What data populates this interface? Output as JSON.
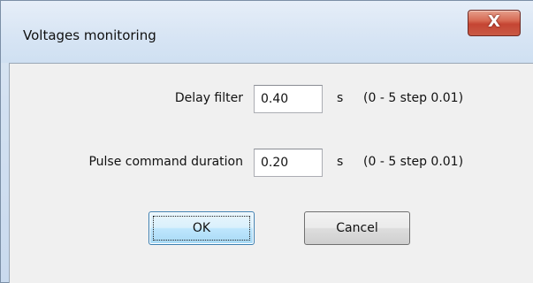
{
  "window": {
    "title": "Voltages monitoring",
    "close_glyph": "X",
    "close_icon": "close-icon"
  },
  "form": {
    "delay_filter": {
      "label": "Delay filter",
      "value": "0.40",
      "unit": "s",
      "range": "(0 - 5 step 0.01)"
    },
    "pulse_command_duration": {
      "label": "Pulse command duration",
      "value": "0.20",
      "unit": "s",
      "range": "(0 - 5 step 0.01)"
    }
  },
  "buttons": {
    "ok_label": "OK",
    "cancel_label": "Cancel"
  },
  "colors": {
    "title_bar": "#d8e5f4",
    "client_background": "#f0f0f0",
    "close_button": "#c54533",
    "default_button_border": "#3c7fb1"
  }
}
